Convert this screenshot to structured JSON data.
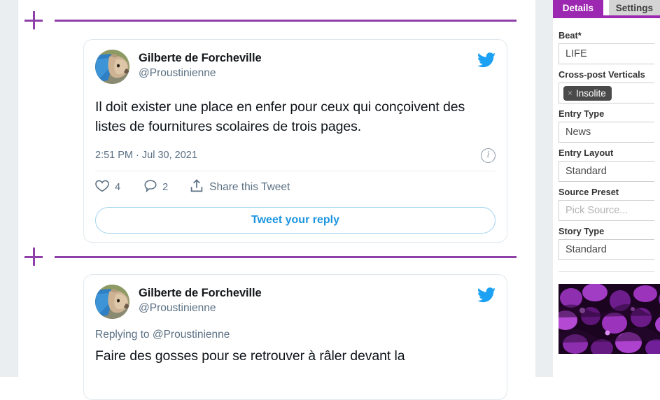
{
  "editor": {
    "insert_rows": [
      {
        "name": "insert-block-top",
        "icon": "plus-icon"
      },
      {
        "name": "insert-block-middle",
        "icon": "plus-icon"
      }
    ],
    "tweets": [
      {
        "display_name": "Gilberte de Forcheville",
        "handle": "@Proustinienne",
        "body": "Il doit exister une place en enfer pour ceux qui conçoivent des listes de fournitures scolaires de trois pages.",
        "timestamp": "2:51 PM · Jul 30, 2021",
        "likes": "4",
        "replies": "2",
        "share_label": "Share this Tweet",
        "reply_button": "Tweet your reply",
        "brand_icon": "twitter-bird-icon",
        "info_icon": "info-icon",
        "like_icon": "heart-icon",
        "reply_icon": "comment-icon",
        "share_icon": "share-icon"
      },
      {
        "display_name": "Gilberte de Forcheville",
        "handle": "@Proustinienne",
        "replying_to": "Replying to @Proustinienne",
        "body": "Faire des gosses pour se retrouver à râler devant la",
        "brand_icon": "twitter-bird-icon"
      }
    ]
  },
  "sidebar": {
    "tabs": [
      {
        "label": "Details",
        "active": true
      },
      {
        "label": "Settings",
        "active": false
      }
    ],
    "fields": [
      {
        "label": "Beat*",
        "value": "LIFE",
        "type": "text"
      },
      {
        "label": "Cross-post Verticals",
        "chip": "Insolite",
        "chip_remove": "×",
        "type": "chips"
      },
      {
        "label": "Entry Type",
        "value": "News",
        "type": "text"
      },
      {
        "label": "Entry Layout",
        "value": "Standard",
        "type": "text"
      },
      {
        "label": "Source Preset",
        "value": "Pick Source...",
        "type": "placeholder"
      },
      {
        "label": "Story Type",
        "value": "Standard",
        "type": "text"
      }
    ],
    "thumbnail": {
      "name": "entry-thumbnail",
      "alt": "purple floral texture"
    }
  },
  "colors": {
    "accent_purple": "#9c27b0",
    "insert_purple": "#8e3fa8",
    "twitter_blue": "#1da1f2",
    "link_blue": "#1b95e0",
    "muted_text": "#5b7083"
  }
}
